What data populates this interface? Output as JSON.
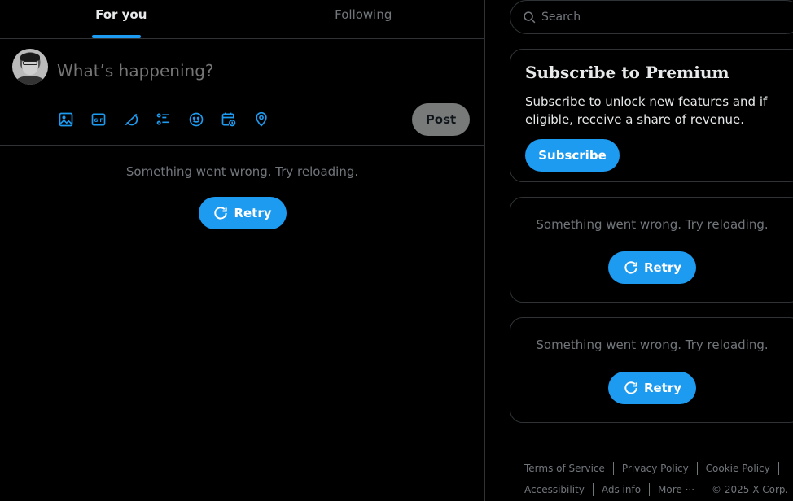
{
  "tabs": [
    {
      "label": "For you",
      "active": true
    },
    {
      "label": "Following",
      "active": false
    }
  ],
  "composer": {
    "placeholder": "What’s happening?",
    "post_label": "Post",
    "tools": [
      "image-icon",
      "gif-icon",
      "grok-icon",
      "poll-icon",
      "emoji-icon",
      "schedule-icon",
      "location-icon"
    ]
  },
  "main_error": {
    "message": "Something went wrong. Try reloading.",
    "retry_label": "Retry"
  },
  "search": {
    "placeholder": "Search"
  },
  "premium": {
    "title": "Subscribe to Premium",
    "description": "Subscribe to unlock new features and if eligible, receive a share of revenue.",
    "button_label": "Subscribe"
  },
  "sidebar_errors": [
    {
      "message": "Something went wrong. Try reloading.",
      "retry_label": "Retry"
    },
    {
      "message": "Something went wrong. Try reloading.",
      "retry_label": "Retry"
    }
  ],
  "footer": {
    "row1": [
      "Terms of Service",
      "Privacy Policy",
      "Cookie Policy"
    ],
    "row2": [
      "Accessibility",
      "Ads info",
      "More ···",
      "© 2025 X Corp."
    ]
  },
  "colors": {
    "accent": "#1d9bf0",
    "background": "#000000",
    "border": "#2f3336",
    "muted": "#71767b"
  }
}
